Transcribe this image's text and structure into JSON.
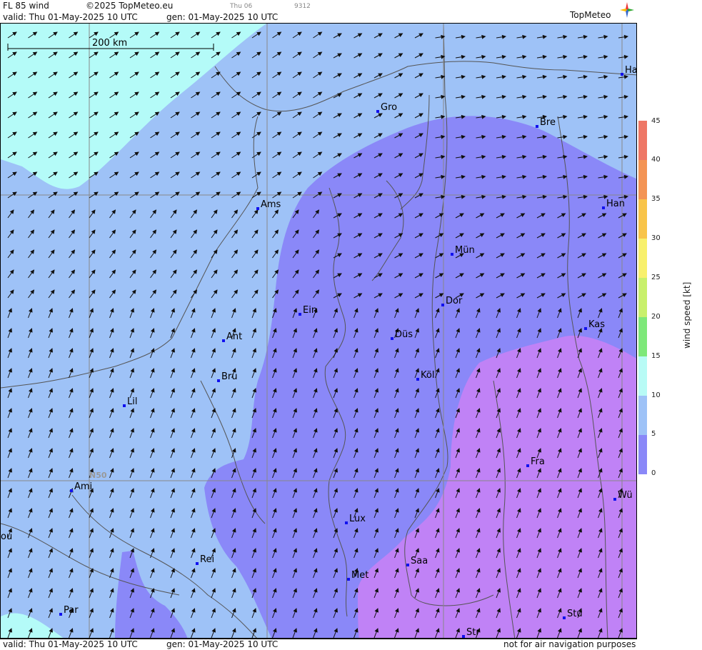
{
  "header": {
    "product": "FL 85 wind",
    "copyright": "©2025 TopMeteo.eu",
    "valid": "valid:  Thu  01-May-2025  10 UTC",
    "gen": "gen: 01-May-2025 10 UTC",
    "small_day": "Thu 06",
    "small_code": "9312",
    "logo": "TopMeteo"
  },
  "footer": {
    "valid": "valid:  Thu  01-May-2025  10 UTC",
    "gen": "gen: 01-May-2025 10 UTC",
    "disclaimer": "not for air navigation purposes"
  },
  "map": {
    "scale_label": "200 km",
    "lat_label": "N50",
    "cities": [
      {
        "name": "Gro"
      },
      {
        "name": "Bre"
      },
      {
        "name": "Ha"
      },
      {
        "name": "Ams"
      },
      {
        "name": "Han"
      },
      {
        "name": "Mün"
      },
      {
        "name": "Ein"
      },
      {
        "name": "Dor"
      },
      {
        "name": "Ant"
      },
      {
        "name": "Düs"
      },
      {
        "name": "Kas"
      },
      {
        "name": "Bru"
      },
      {
        "name": "Köl"
      },
      {
        "name": "Lil"
      },
      {
        "name": "Fra"
      },
      {
        "name": "Ami"
      },
      {
        "name": "Wü"
      },
      {
        "name": "ou"
      },
      {
        "name": "Lux"
      },
      {
        "name": "Rei"
      },
      {
        "name": "Saa"
      },
      {
        "name": "Met"
      },
      {
        "name": "Par"
      },
      {
        "name": "Stu"
      },
      {
        "name": "Str"
      }
    ],
    "colors": {
      "cyan": "#b4fbf8",
      "lightblue": "#9ec2f7",
      "blue": "#8a88f8",
      "purple": "#c082f6",
      "grid": "#888888"
    }
  },
  "legend": {
    "title": "wind  speed  [kt]",
    "ticks": [
      "45",
      "40",
      "35",
      "30",
      "25",
      "20",
      "15",
      "10",
      "5",
      "0"
    ],
    "stops": [
      "#ee7766",
      "#f39455",
      "#f8c44a",
      "#f8f06c",
      "#c8f06c",
      "#7ee87a",
      "#b8fbf6",
      "#9ec2f7",
      "#8a88f8",
      "#c082f6"
    ]
  }
}
